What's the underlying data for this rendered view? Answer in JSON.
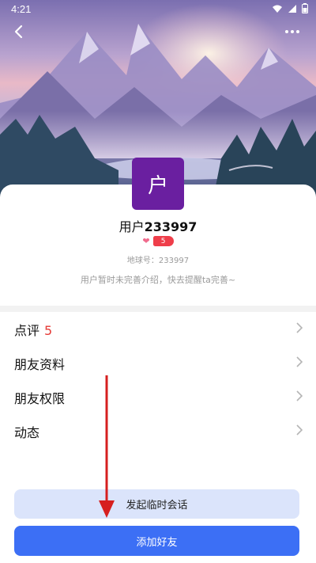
{
  "status_bar": {
    "time": "4:21"
  },
  "profile": {
    "avatar_char": "户",
    "username_prefix": "用户",
    "username_number": "233997",
    "level": "5",
    "earth_id": "地球号：233997",
    "intro": "用户暂时未完善介绍，快去提醒ta完善~"
  },
  "menu": {
    "items": [
      {
        "label": "点评",
        "count": "5"
      },
      {
        "label": "朋友资料"
      },
      {
        "label": "朋友权限"
      },
      {
        "label": "动态"
      }
    ]
  },
  "buttons": {
    "temp_chat": "发起临时会话",
    "add_friend": "添加好友"
  },
  "colors": {
    "avatar_bg": "#6a1fa0",
    "primary_button": "#3c6ff5",
    "secondary_button": "#dbe4fb",
    "count_red": "#e53935",
    "annotation": "#d61f1f"
  }
}
